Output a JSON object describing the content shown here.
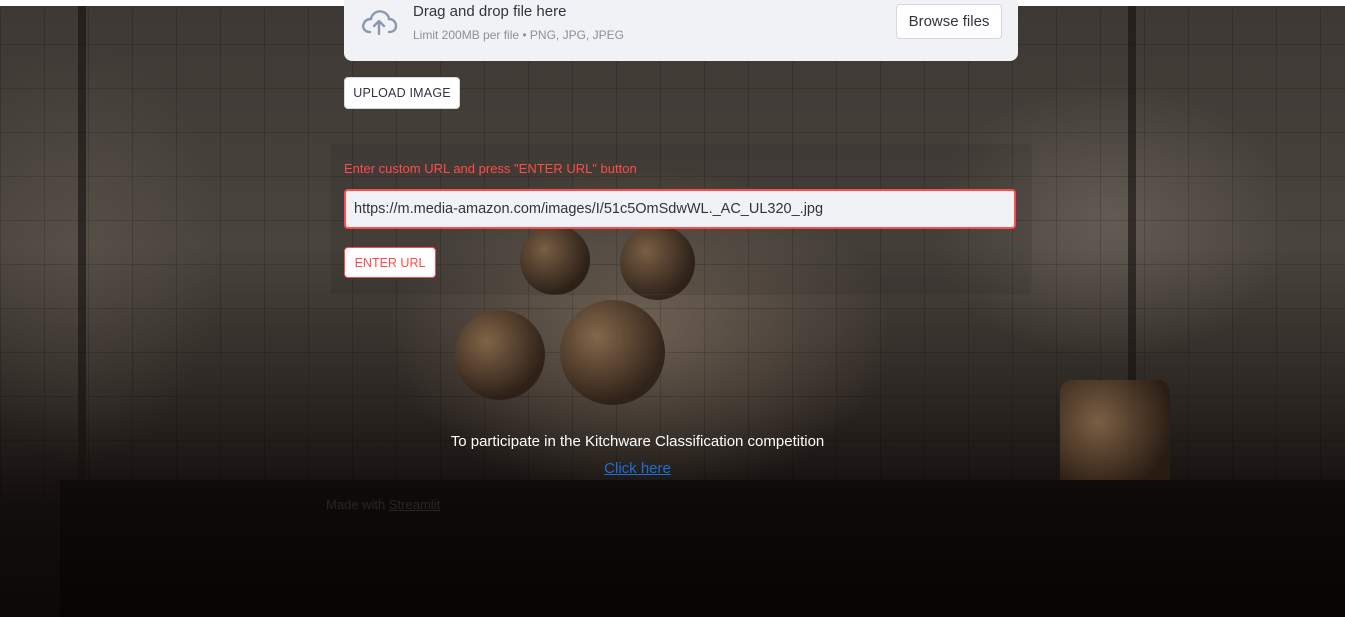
{
  "uploader": {
    "icon": "cloud-upload-icon",
    "title": "Drag and drop file here",
    "limit": "Limit 200MB per file • PNG, JPG, JPEG",
    "browse_label": "Browse files"
  },
  "upload_button": "UPLOAD IMAGE",
  "url_section": {
    "label": "Enter custom URL and press \"ENTER URL\" button",
    "value": "https://m.media-amazon.com/images/I/51c5OmSdwWL._AC_UL320_.jpg",
    "button": "ENTER URL"
  },
  "competition": {
    "text": "To participate in the Kitchware Classification competition",
    "link": "Click here"
  },
  "footer": {
    "prefix": "Made with ",
    "link": "Streamlit"
  },
  "colors": {
    "accent": "#ff4b4b",
    "link": "#1e6fd9",
    "panel": "#f0f2f6"
  }
}
